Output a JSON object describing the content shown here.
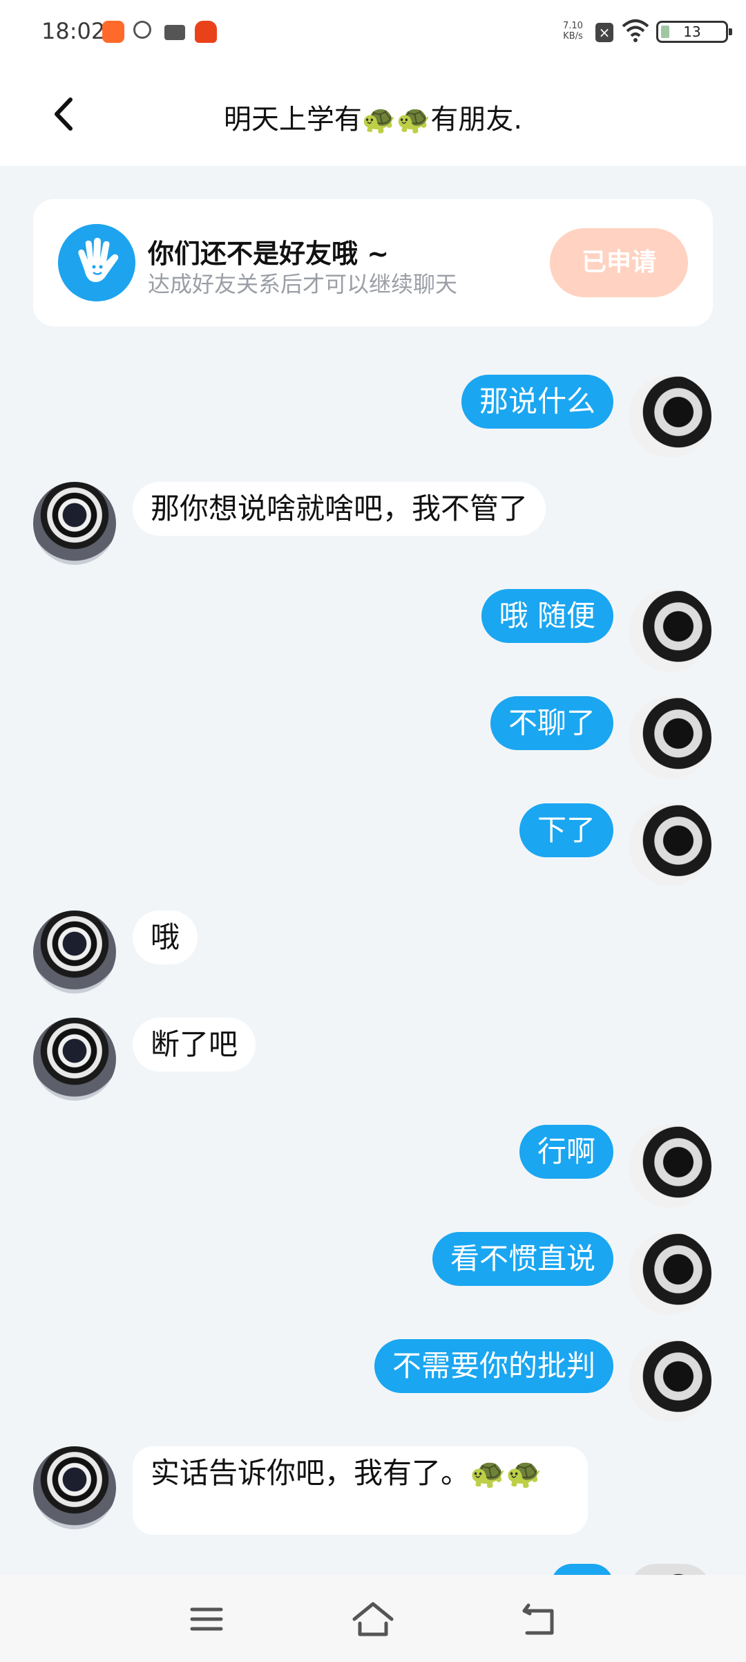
{
  "status_bar": {
    "time": "18:02",
    "net_speed_value": "7.10",
    "net_speed_unit": "KB/s",
    "battery": "13"
  },
  "header": {
    "title": "明天上学有🐢🐢有朋友."
  },
  "friend_banner": {
    "title": "你们还不是好友哦 ~",
    "subtitle": "达成好友关系后才可以继续聊天",
    "button_label": "已申请"
  },
  "messages": [
    {
      "sender": "me",
      "text": "那说什么"
    },
    {
      "sender": "them",
      "text": "那你想说啥就啥吧，我不管了"
    },
    {
      "sender": "me",
      "text": "哦 随便"
    },
    {
      "sender": "me",
      "text": "不聊了"
    },
    {
      "sender": "me",
      "text": "下了"
    },
    {
      "sender": "them",
      "text": "哦"
    },
    {
      "sender": "them",
      "text": "断了吧"
    },
    {
      "sender": "me",
      "text": "行啊"
    },
    {
      "sender": "me",
      "text": "看不惯直说"
    },
    {
      "sender": "me",
      "text": "不需要你的批判"
    },
    {
      "sender": "them",
      "text": "实话告诉你吧，我有了。🐢🐢"
    }
  ],
  "colors": {
    "accent": "#1aa6f1",
    "background": "#f2f5f8",
    "applied_button": "#ffd2c1"
  }
}
